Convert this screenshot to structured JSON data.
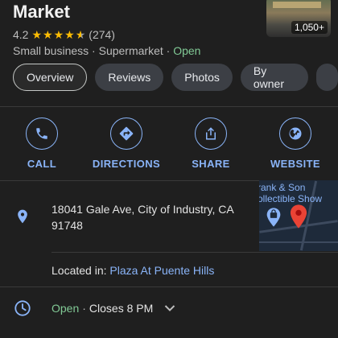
{
  "place": {
    "title": "Market",
    "photo_count": "1,050+",
    "rating": "4.2",
    "stars_filled": 4.2,
    "review_count": "(274)",
    "category_1": "Small business",
    "category_2": "Supermarket",
    "status": "Open",
    "separator": "·"
  },
  "tabs": [
    {
      "label": "Overview"
    },
    {
      "label": "Reviews"
    },
    {
      "label": "Photos"
    },
    {
      "label": "By owner"
    }
  ],
  "actions": [
    {
      "label": "CALL",
      "icon": "phone-icon"
    },
    {
      "label": "DIRECTIONS",
      "icon": "directions-icon"
    },
    {
      "label": "SHARE",
      "icon": "share-icon"
    },
    {
      "label": "WEBSITE",
      "icon": "globe-icon"
    }
  ],
  "address": {
    "line1": "18041 Gale Ave, City of Industry, CA",
    "line2": "91748"
  },
  "map": {
    "label_1": "rank & Son",
    "label_2": "ollectible Show"
  },
  "located": {
    "prefix": "Located in:",
    "link": "Plaza At Puente Hills"
  },
  "hours": {
    "status": "Open",
    "separator": "·",
    "closes": "Closes 8 PM"
  },
  "colors": {
    "background": "#1f1f1f",
    "accent": "#8ab4f8",
    "open_green": "#81c995",
    "star": "#fbbc04"
  }
}
